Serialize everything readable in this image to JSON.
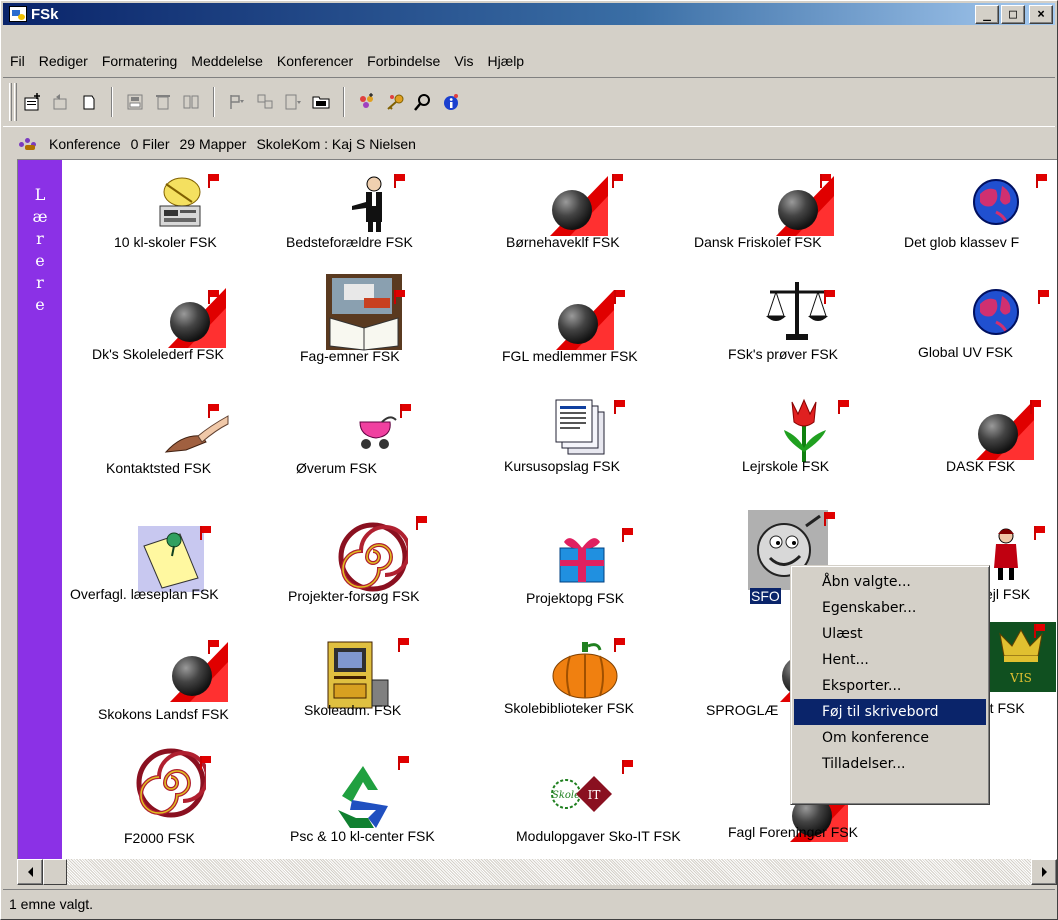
{
  "window": {
    "title": "FSk"
  },
  "menu": [
    "Fil",
    "Rediger",
    "Formatering",
    "Meddelelse",
    "Konferencer",
    "Forbindelse",
    "Vis",
    "Hjælp"
  ],
  "info": {
    "type": "Konference",
    "files": "0 Filer",
    "folders": "29 Mapper",
    "user": "SkoleKom : Kaj S Nielsen"
  },
  "sidebar": {
    "chars": [
      "L",
      "æ",
      "r",
      "e",
      "r",
      "e"
    ]
  },
  "items": [
    {
      "label": "10 kl-skoler FSK",
      "icon": "radio-satellite-icon"
    },
    {
      "label": "Bedsteforældre FSK",
      "icon": "grandparent-icon"
    },
    {
      "label": "Børnehaveklf FSK",
      "icon": "conference-ball-icon"
    },
    {
      "label": "Dansk Friskolef FSK",
      "icon": "conference-ball-icon"
    },
    {
      "label": "Det glob klassev F",
      "icon": "globe-icon"
    },
    {
      "label": "Dk's Skolelederf FSK",
      "icon": "conference-ball-icon"
    },
    {
      "label": "Fag-emner FSK",
      "icon": "books-icon"
    },
    {
      "label": "FGL medlemmer FSK",
      "icon": "conference-ball-icon"
    },
    {
      "label": "FSk's prøver FSK",
      "icon": "scales-icon"
    },
    {
      "label": "Global UV FSK",
      "icon": "globe-icon"
    },
    {
      "label": "Kontaktsted FSK",
      "icon": "hands-icon"
    },
    {
      "label": "Øverum FSK",
      "icon": "pram-icon"
    },
    {
      "label": "Kursusopslag FSK",
      "icon": "documents-icon"
    },
    {
      "label": "Lejrskole FSK",
      "icon": "tulip-icon"
    },
    {
      "label": "DASK FSK",
      "icon": "conference-ball-icon"
    },
    {
      "label": "Overfagl. læseplan FSK",
      "icon": "note-pin-icon"
    },
    {
      "label": "Projekter-forsøg FSK",
      "icon": "spiral-icon"
    },
    {
      "label": "Projektopg FSK",
      "icon": "gift-icon"
    },
    {
      "label": "SFO",
      "icon": "smiley-icon"
    },
    {
      "label": "vejl FSK",
      "icon": "figure-icon"
    },
    {
      "label": "Skokons Landsf FSK",
      "icon": "conference-ball-icon"
    },
    {
      "label": "Skoleadm. FSK",
      "icon": "computer-icon"
    },
    {
      "label": "Skolebiblioteker FSK",
      "icon": "pumpkin-icon"
    },
    {
      "label": "SPROGLÆ",
      "icon": "conference-ball-icon"
    },
    {
      "label": "tet FSK",
      "icon": "crown-icon"
    },
    {
      "label": "F2000 FSK",
      "icon": "spiral-icon"
    },
    {
      "label": "Psc & 10 kl-center FSK",
      "icon": "recycle-icon"
    },
    {
      "label": "Modulopgaver Sko-IT FSK",
      "icon": "skole-it-icon"
    },
    {
      "label": "Fagl Foreninger FSK",
      "icon": "conference-ball-icon"
    }
  ],
  "context_menu": [
    "Åbn valgte...",
    "Egenskaber...",
    "Ulæst",
    "Hent...",
    "Eksporter...",
    "Føj til skrivebord",
    "Om konference",
    "Tilladelser..."
  ],
  "context_menu_active": "Føj til skrivebord",
  "status": "1 emne valgt.",
  "window_buttons": {
    "minimize": "_",
    "maximize": "□",
    "close": "×"
  }
}
